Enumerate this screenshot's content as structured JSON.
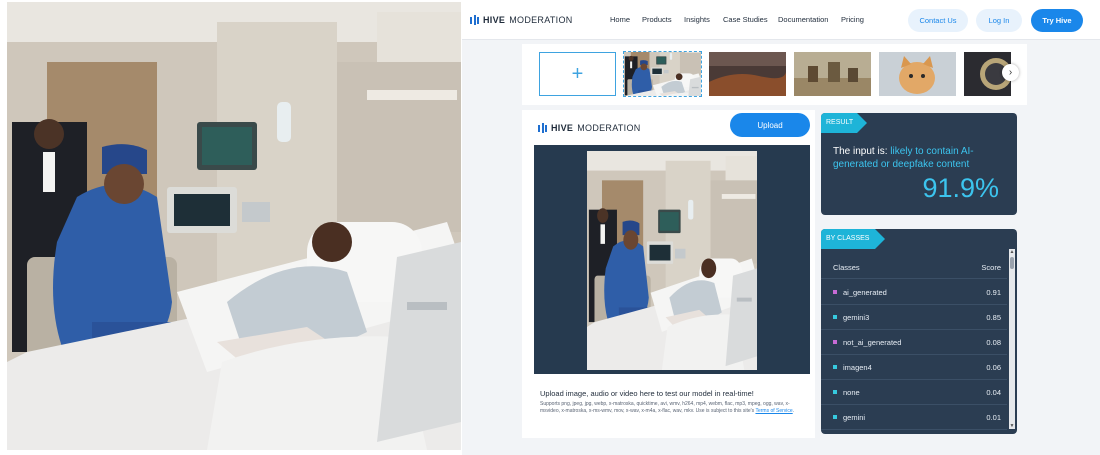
{
  "navbar": {
    "brand_bold": "HIVE",
    "brand_light": "MODERATION",
    "links": [
      "Home",
      "Products",
      "Insights",
      "Case Studies",
      "Documentation",
      "Pricing"
    ],
    "contact_label": "Contact Us",
    "login_label": "Log In",
    "try_label": "Try Hive"
  },
  "thumbnails": {
    "add_symbol": "+",
    "next_symbol": "›"
  },
  "upload_card": {
    "brand_bold": "HIVE",
    "brand_light": "MODERATION",
    "upload_label": "Upload",
    "heading": "Upload image, audio or video here to test our model in real-time!",
    "supports_text": "Supports png, jpeg, jpg, webp, x-matroska, quicktime, avi, wmv, h264, mp4, webm, flac, mp3, mpeg, ogg, wav, x-msvideo, x-matroska, x-ms-wmv, mov, x-wav, x-m4a, x-flac, wav, mkv. Use is subject to this site's",
    "terms_link": "Terms of Service",
    "terms_end": "."
  },
  "result": {
    "tag": "RESULT",
    "prefix": "The input is:",
    "verdict": "likely to contain AI-generated or deepfake content",
    "score": "91.9%"
  },
  "classes": {
    "tag": "BY CLASSES",
    "header_classes": "Classes",
    "header_score": "Score",
    "rows": [
      {
        "name": "ai_generated",
        "score": "0.91",
        "color": "#c86bd6"
      },
      {
        "name": "gemini3",
        "score": "0.85",
        "color": "#36c9de"
      },
      {
        "name": "not_ai_generated",
        "score": "0.08",
        "color": "#c86bd6"
      },
      {
        "name": "imagen4",
        "score": "0.06",
        "color": "#36c9de"
      },
      {
        "name": "none",
        "score": "0.04",
        "color": "#36c9de"
      },
      {
        "name": "gemini",
        "score": "0.01",
        "color": "#36c9de"
      }
    ]
  },
  "colors": {
    "accent": "#1a87ea",
    "result_cyan": "#3cc4ee",
    "card_dark": "#2b3d52"
  }
}
